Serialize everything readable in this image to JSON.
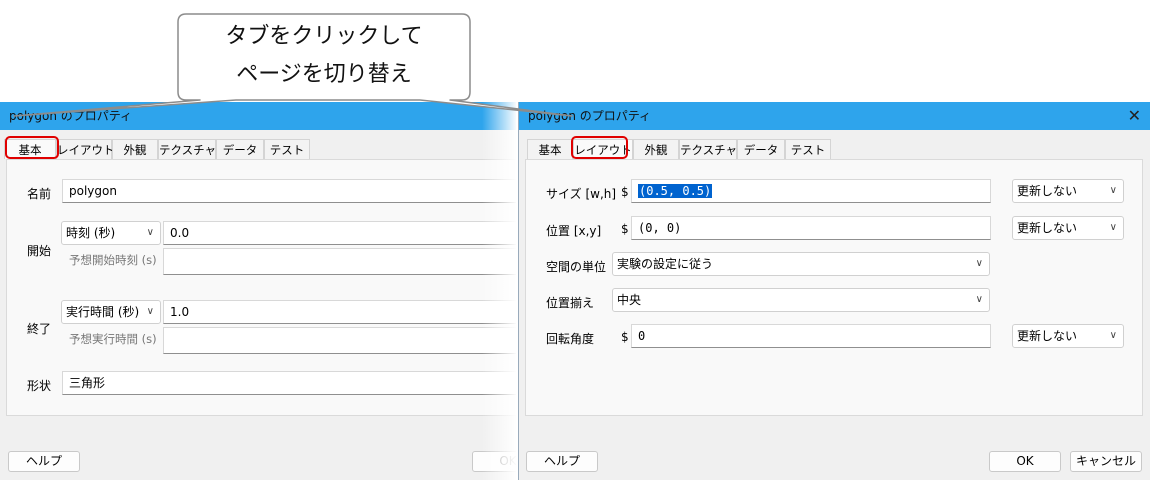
{
  "callout": {
    "line1": "タブをクリックして",
    "line2": "ページを切り替え"
  },
  "left_window": {
    "title": "polygon のプロパティ",
    "tabs": [
      "基本",
      "レイアウト",
      "外観",
      "テクスチャ",
      "データ",
      "テスト"
    ],
    "active_tab": "基本",
    "fields": {
      "name_label": "名前",
      "name_value": "polygon",
      "start_label": "開始",
      "start_type": "時刻 (秒)",
      "start_value": "0.0",
      "start_expected_label": "予想開始時刻 (s)",
      "end_label": "終了",
      "end_type": "実行時間 (秒)",
      "end_value": "1.0",
      "end_expected_label": "予想実行時間 (s)",
      "shape_label": "形状",
      "shape_value": "三角形"
    },
    "buttons": {
      "help": "ヘルプ",
      "ok": "OK"
    }
  },
  "right_window": {
    "title": "polygon のプロパティ",
    "tabs": [
      "基本",
      "レイアウト",
      "外観",
      "テクスチャ",
      "データ",
      "テスト"
    ],
    "active_tab": "レイアウト",
    "fields": {
      "size_label": "サイズ [w,h]",
      "size_value": "(0.5, 0.5)",
      "size_update": "更新しない",
      "pos_label": "位置 [x,y]",
      "pos_value": "(0, 0)",
      "pos_update": "更新しない",
      "units_label": "空間の単位",
      "units_value": "実験の設定に従う",
      "anchor_label": "位置揃え",
      "anchor_value": "中央",
      "ori_label": "回転角度",
      "ori_value": "0",
      "ori_update": "更新しない",
      "dollar": "$"
    },
    "buttons": {
      "help": "ヘルプ",
      "ok": "OK",
      "cancel": "キャンセル"
    }
  },
  "colors": {
    "titlebar": "#2ea4ec",
    "highlight": "#e00000",
    "selection": "#0063cf"
  }
}
